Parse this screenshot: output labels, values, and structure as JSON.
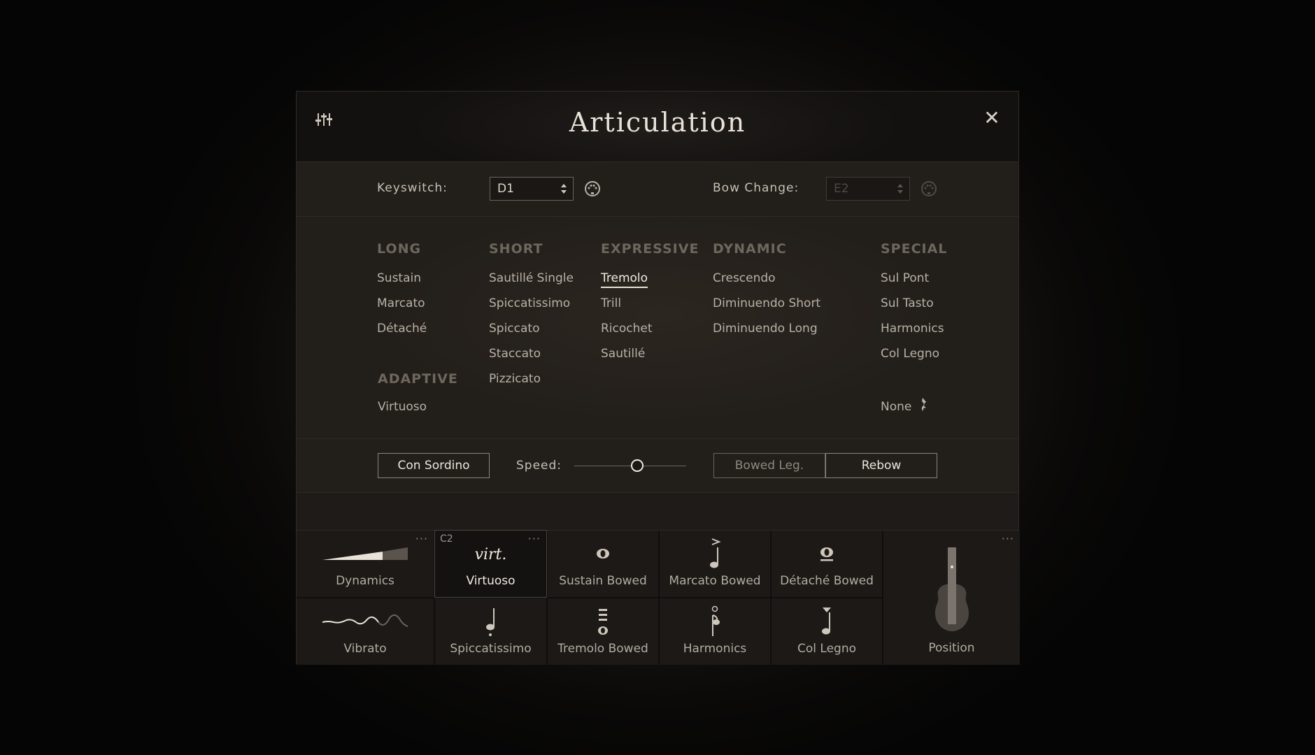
{
  "header": {
    "title": "Articulation"
  },
  "keyswitch": {
    "label": "Keyswitch:",
    "value": "D1"
  },
  "bow_change": {
    "label": "Bow Change:",
    "value": "E2"
  },
  "categories": {
    "long": {
      "title": "LONG",
      "items": [
        "Sustain",
        "Marcato",
        "Détaché"
      ]
    },
    "adaptive": {
      "title": "ADAPTIVE",
      "items": [
        "Virtuoso"
      ]
    },
    "short": {
      "title": "SHORT",
      "items": [
        "Sautillé Single",
        "Spiccatissimo",
        "Spiccato",
        "Staccato",
        "Pizzicato"
      ]
    },
    "expressive": {
      "title": "EXPRESSIVE",
      "items": [
        "Tremolo",
        "Trill",
        "Ricochet",
        "Sautillé"
      ],
      "selected": "Tremolo"
    },
    "dynamic": {
      "title": "DYNAMIC",
      "items": [
        "Crescendo",
        "Diminuendo Short",
        "Diminuendo Long"
      ]
    },
    "special": {
      "title": "SPECIAL",
      "items": [
        "Sul Pont",
        "Sul Tasto",
        "Harmonics",
        "Col Legno"
      ],
      "none": "None"
    }
  },
  "controls": {
    "con_sordino": "Con Sordino",
    "speed_label": "Speed:",
    "speed_value": 0.56,
    "bowed_leg": "Bowed Leg.",
    "rebow": "Rebow"
  },
  "cells": {
    "dynamics": "Dynamics",
    "vibrato": "Vibrato",
    "virtuoso": {
      "label": "Virtuoso",
      "glyph": "virt.",
      "keyswitch": "C2"
    },
    "sustain_bowed": "Sustain Bowed",
    "marcato_bowed": "Marcato Bowed",
    "detache_bowed": "Détaché Bowed",
    "spiccatissimo": "Spiccatissimo",
    "tremolo_bowed": "Tremolo Bowed",
    "harmonics": "Harmonics",
    "col_legno": "Col Legno",
    "position": "Position",
    "more": "···"
  },
  "colors": {
    "accent": "#f0eae0",
    "muted": "#6e675e",
    "panel": "#1b1814"
  }
}
